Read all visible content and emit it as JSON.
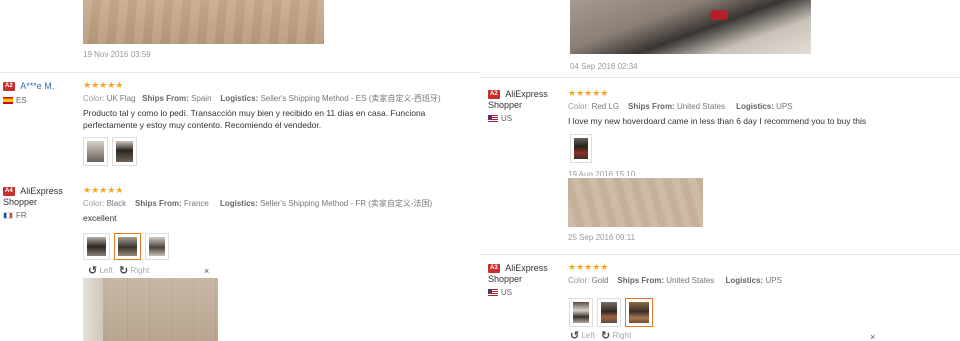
{
  "left": {
    "top_date": "19 Nov 2016 03:59",
    "reviews": [
      {
        "badge": "A2",
        "name": "A***e M.",
        "country": "ES",
        "stars": "★★★★★",
        "color_label": "Color:",
        "color_value": "UK Flag",
        "ships_label": "Ships From:",
        "ships_value": "Spain",
        "logistics_label": "Logistics:",
        "logistics_value": "Seller's Shipping Method - ES (卖家自定义-西班牙)",
        "text": "Producto tal y como lo pedí. Transacción muy bien y recibido en 11 días en casa. Funciona perfectamente y estoy muy contento. Recomiendo el vendedor."
      },
      {
        "badge": "A4",
        "name": "AliExpress Shopper",
        "country": "FR",
        "stars": "★★★★★",
        "color_label": "Color:",
        "color_value": "Black",
        "ships_label": "Ships From:",
        "ships_value": "France",
        "logistics_label": "Logistics:",
        "logistics_value": "Seller's Shipping Method - FR (卖家自定义-法国)",
        "text": "excellent",
        "viewer": {
          "left_label": "Left",
          "right_label": "Right",
          "close": "×"
        }
      }
    ]
  },
  "right": {
    "top_date": "04 Sep 2016 02:34",
    "reviews": [
      {
        "badge": "A2",
        "name": "AliExpress Shopper",
        "country": "US",
        "stars": "★★★★★",
        "color_label": "Color:",
        "color_value": "Red LG",
        "ships_label": "Ships From:",
        "ships_value": "United States",
        "logistics_label": "Logistics:",
        "logistics_value": "UPS",
        "text": "I love my new hoverdoard came in less than 6 day I recommend you to buy this",
        "partial_date": "19 Aug 2016 15:10",
        "date": "25 Sep 2016 09:11"
      },
      {
        "badge": "A3",
        "name": "AliExpress Shopper",
        "country": "US",
        "stars": "★★★★★",
        "color_label": "Color:",
        "color_value": "Gold",
        "ships_label": "Ships From:",
        "ships_value": "United States",
        "logistics_label": "Logistics:",
        "logistics_value": "UPS",
        "viewer": {
          "left_label": "Left",
          "right_label": "Right",
          "close": "×"
        }
      }
    ]
  }
}
